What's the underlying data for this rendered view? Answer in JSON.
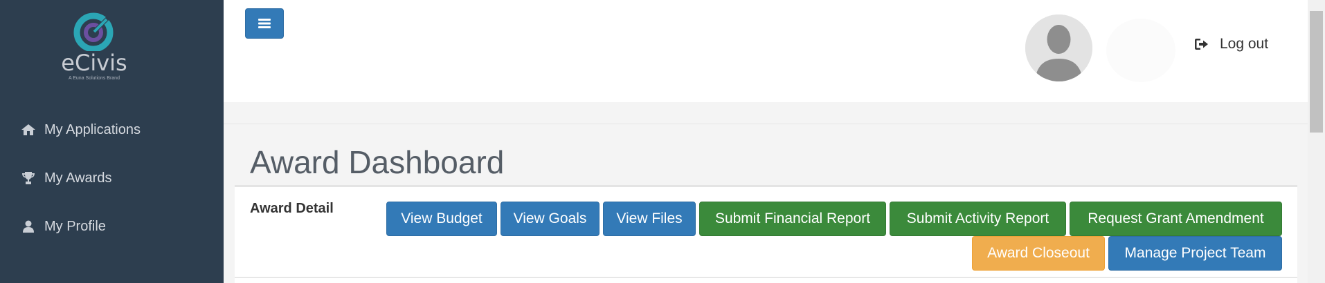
{
  "brand": {
    "name": "eCivis",
    "tagline": "A Euna Solutions Brand",
    "colors": {
      "logo_teal": "#2ba6b5",
      "logo_purple": "#6b4fa0"
    }
  },
  "sidebar": {
    "items": [
      {
        "label": "My Applications",
        "icon": "home-icon"
      },
      {
        "label": "My Awards",
        "icon": "trophy-icon"
      },
      {
        "label": "My Profile",
        "icon": "user-icon"
      }
    ]
  },
  "header": {
    "menu_icon": "hamburger-icon",
    "logout_label": "Log out",
    "logout_icon": "sign-out-icon"
  },
  "main": {
    "title": "Award Dashboard",
    "section_label": "Award Detail",
    "buttons": [
      {
        "label": "View Budget",
        "style": "primary"
      },
      {
        "label": "View Goals",
        "style": "primary"
      },
      {
        "label": "View Files",
        "style": "primary"
      },
      {
        "label": "Submit Financial Report",
        "style": "success"
      },
      {
        "label": "Submit Activity Report",
        "style": "success"
      },
      {
        "label": "Request Grant Amendment",
        "style": "success"
      },
      {
        "label": "Award Closeout",
        "style": "warning"
      },
      {
        "label": "Manage Project Team",
        "style": "primary"
      }
    ]
  },
  "colors": {
    "sidebar_bg": "#2d3e4f",
    "primary": "#337ab7",
    "success": "#3b8a3b",
    "warning": "#f0ad4e"
  }
}
